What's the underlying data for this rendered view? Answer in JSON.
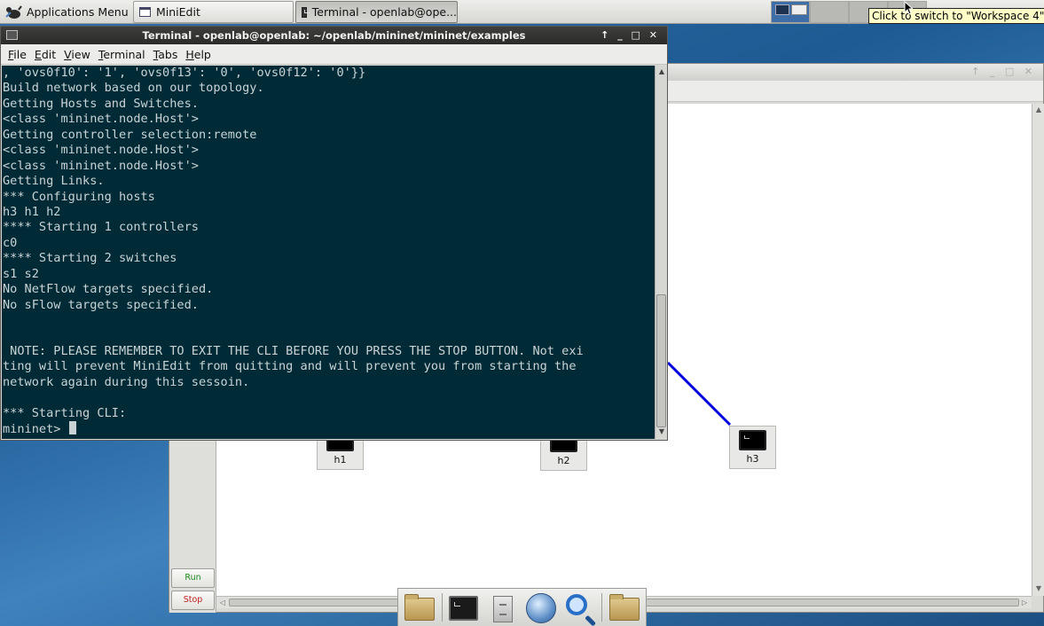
{
  "panel": {
    "app_menu_label": "Applications Menu",
    "tasks": [
      {
        "label": "MiniEdit"
      },
      {
        "label": "Terminal - openlab@ope..."
      }
    ],
    "tooltip": "Click to switch to \"Workspace 4\""
  },
  "terminal": {
    "title": "Terminal - openlab@openlab: ~/openlab/mininet/mininet/examples",
    "window_controls": "↑ _ □ ✕",
    "menu": [
      "File",
      "Edit",
      "View",
      "Terminal",
      "Tabs",
      "Help"
    ],
    "lines": [
      ", 'ovs0f10': '1', 'ovs0f13': '0', 'ovs0f12': '0'}}",
      "Build network based on our topology.",
      "Getting Hosts and Switches.",
      "<class 'mininet.node.Host'>",
      "Getting controller selection:remote",
      "<class 'mininet.node.Host'>",
      "<class 'mininet.node.Host'>",
      "Getting Links.",
      "*** Configuring hosts",
      "h3 h1 h2",
      "**** Starting 1 controllers",
      "c0",
      "**** Starting 2 switches",
      "s1 s2",
      "No NetFlow targets specified.",
      "No sFlow targets specified.",
      "",
      "",
      " NOTE: PLEASE REMEMBER TO EXIT THE CLI BEFORE YOU PRESS THE STOP BUTTON. Not exi",
      "ting will prevent MiniEdit from quitting and will prevent you from starting the",
      "network again during this sessoin.",
      "",
      "*** Starting CLI:"
    ],
    "prompt": "mininet> "
  },
  "miniedit": {
    "window_controls": "↑ _ □ ✕",
    "run_label": "Run",
    "stop_label": "Stop",
    "nodes": [
      {
        "label": "h1"
      },
      {
        "label": "h2"
      },
      {
        "label": "h3"
      }
    ],
    "link_color": "#0000dd"
  },
  "dock": {
    "items": [
      "folder-icon",
      "terminal-icon",
      "file-cabinet-icon",
      "web-browser-icon",
      "search-icon",
      "home-folder-icon"
    ]
  },
  "colors": {
    "terminal_bg": "#002b36",
    "terminal_fg": "#c9d3d6",
    "run_text": "#1f8a1f",
    "stop_text": "#c02020",
    "tooltip_bg": "#ffffc8"
  }
}
